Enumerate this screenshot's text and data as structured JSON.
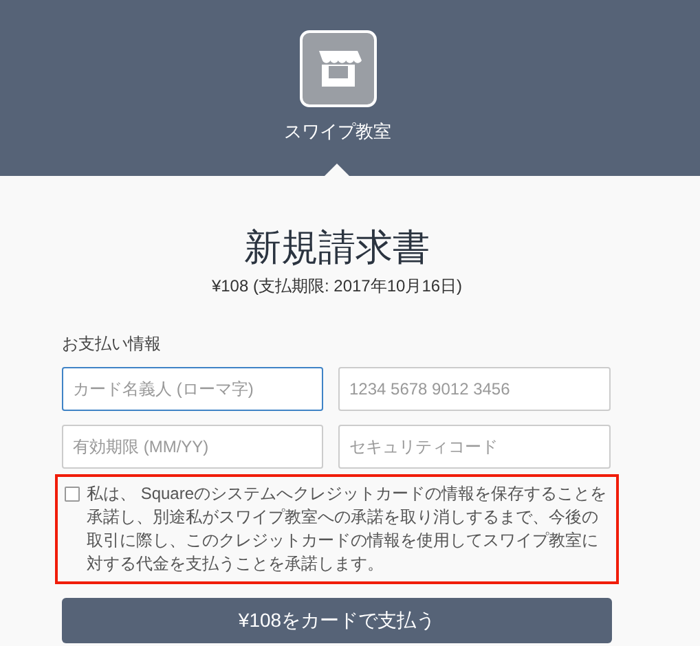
{
  "header": {
    "shop_name": "スワイプ教室"
  },
  "invoice": {
    "title": "新規請求書",
    "subtitle": "¥108 (支払期限: 2017年10月16日)"
  },
  "payment": {
    "section_label": "お支払い情報",
    "fields": [
      {
        "placeholder": "カード名義人 (ローマ字)",
        "focused": true
      },
      {
        "placeholder": "1234 5678 9012 3456",
        "focused": false
      },
      {
        "placeholder": "有効期限 (MM/YY)",
        "focused": false
      },
      {
        "placeholder": "セキュリティコード",
        "focused": false
      }
    ],
    "consent": {
      "checked": false,
      "highlighted": true,
      "text": "私は、 Squareのシステムへクレジットカードの情報を保存することを承諾し、別途私がスワイプ教室への承諾を取り消しするまで、今後の取引に際し、このクレジットカードの情報を使用してスワイプ教室に対する代金を支払うことを承諾します。"
    },
    "pay_button": "¥108をカードで支払う"
  }
}
